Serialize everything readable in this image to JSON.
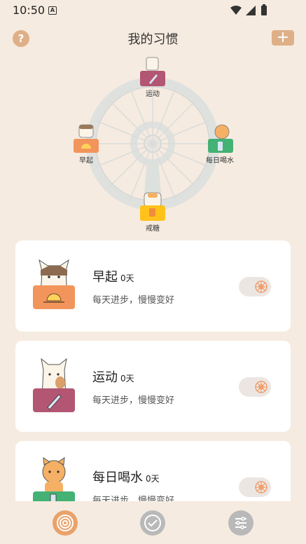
{
  "status": {
    "time": "10:50",
    "notif": "A"
  },
  "header": {
    "title": "我的习惯",
    "help": "?",
    "add": "+"
  },
  "wheel": {
    "labels": [
      "运动",
      "早起",
      "每日喝水",
      "戒糖"
    ],
    "colors": {
      "sport": "#b25673",
      "wake": "#f2955c",
      "water": "#44b175",
      "sugar": "#ffc21a"
    }
  },
  "habits": [
    {
      "name": "早起",
      "days": "0天",
      "slogan": "每天进步，慢慢变好",
      "color": "#f2955c",
      "icon": "sunrise-icon"
    },
    {
      "name": "运动",
      "days": "0天",
      "slogan": "每天进步，慢慢变好",
      "color": "#b25673",
      "icon": "rocket-icon"
    },
    {
      "name": "每日喝水",
      "days": "0天",
      "slogan": "每天进步，慢慢变好",
      "color": "#44b175",
      "icon": "water-bottle-icon"
    }
  ],
  "tabs": [
    {
      "name": "wheel",
      "active": true
    },
    {
      "name": "check",
      "active": false
    },
    {
      "name": "settings",
      "active": false
    }
  ]
}
